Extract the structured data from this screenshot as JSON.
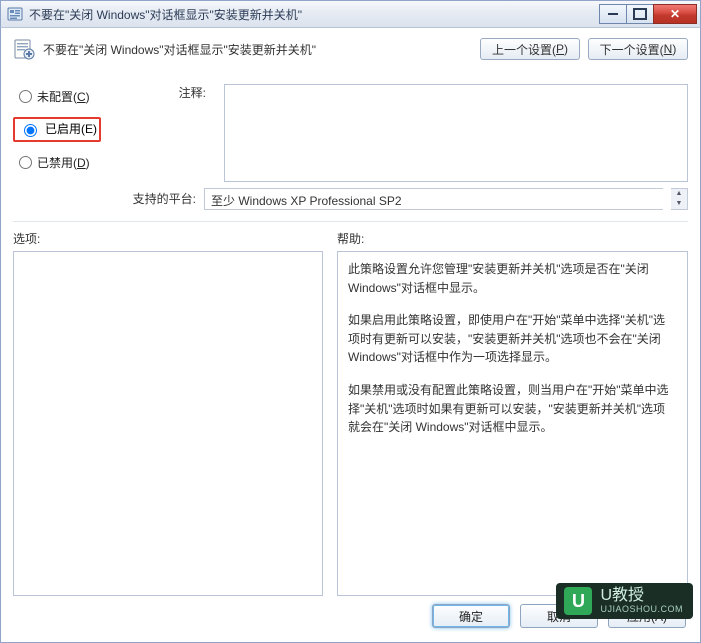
{
  "titlebar": {
    "title": "不要在\"关闭 Windows\"对话框显示\"安装更新并关机\""
  },
  "header": {
    "title": "不要在\"关闭 Windows\"对话框显示\"安装更新并关机\"",
    "prev_label": "上一个设置(",
    "prev_hotkey": "P",
    "prev_suffix": ")",
    "next_label": "下一个设置(",
    "next_hotkey": "N",
    "next_suffix": ")"
  },
  "radios": {
    "not_configured": "未配置(",
    "not_configured_hotkey": "C",
    "not_configured_suffix": ")",
    "enabled": "已启用(",
    "enabled_hotkey": "E",
    "enabled_suffix": ")",
    "disabled": "已禁用(",
    "disabled_hotkey": "D",
    "disabled_suffix": ")"
  },
  "labels": {
    "comment": "注释:",
    "platform": "支持的平台:",
    "options": "选项:",
    "help": "帮助:"
  },
  "fields": {
    "comment_value": "",
    "platform_value": "至少 Windows XP Professional SP2"
  },
  "help": {
    "p1": "此策略设置允许您管理\"安装更新并关机\"选项是否在\"关闭 Windows\"对话框中显示。",
    "p2": "如果启用此策略设置，即使用户在\"开始\"菜单中选择\"关机\"选项时有更新可以安装，\"安装更新并关机\"选项也不会在\"关闭 Windows\"对话框中作为一项选择显示。",
    "p3": "如果禁用或没有配置此策略设置，则当用户在\"开始\"菜单中选择\"关机\"选项时如果有更新可以安装，\"安装更新并关机\"选项就会在\"关闭 Windows\"对话框中显示。"
  },
  "footer": {
    "ok": "确定",
    "cancel": "取消",
    "apply": "应用(A)"
  },
  "watermark": {
    "brand": "U教授",
    "sub": "UJIAOSHOU.COM"
  },
  "icons": {
    "app": "settings-icon",
    "header": "policy-sheet-icon"
  }
}
